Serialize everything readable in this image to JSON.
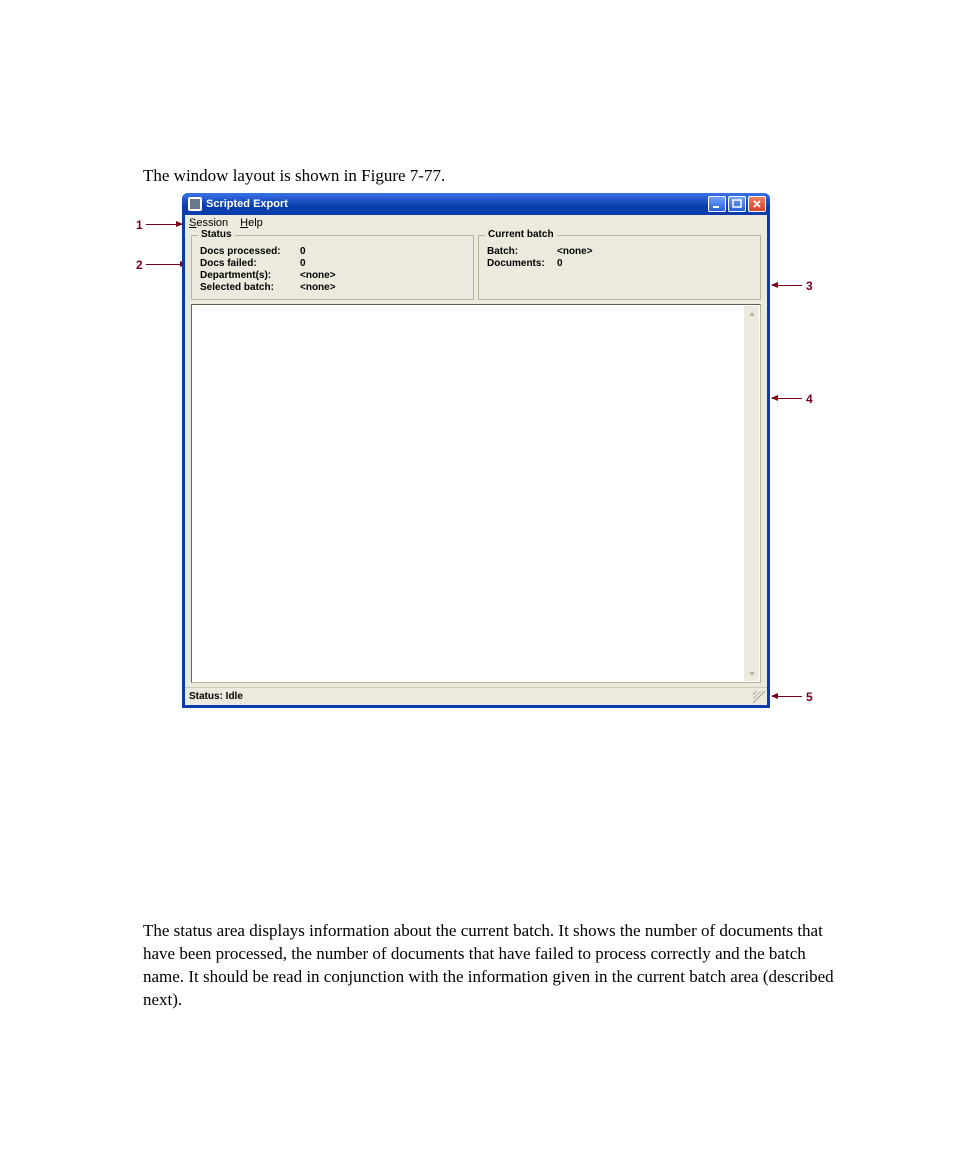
{
  "intro": "The window layout is shown in Figure 7-77.",
  "window": {
    "title": "Scripted Export",
    "menu": {
      "session": "Session",
      "help": "Help"
    },
    "buttons": {
      "min": "minimize",
      "max": "maximize",
      "close": "close"
    }
  },
  "status": {
    "title": "Status",
    "rows": [
      {
        "label": "Docs processed:",
        "value": "0"
      },
      {
        "label": "Docs failed:",
        "value": "0"
      },
      {
        "label": "Department(s):",
        "value": "<none>"
      },
      {
        "label": "Selected batch:",
        "value": "<none>"
      }
    ]
  },
  "current_batch": {
    "title": "Current batch",
    "rows": [
      {
        "label": "Batch:",
        "value": "<none>"
      },
      {
        "label": "Documents:",
        "value": "0"
      }
    ]
  },
  "statusbar": "Status: Idle",
  "callouts": {
    "c1": "1",
    "c2": "2",
    "c3": "3",
    "c4": "4",
    "c5": "5"
  },
  "para2": "The status area displays information about the current batch. It shows the number of documents that have been processed, the number of documents that have failed to process correctly and the batch name. It should be read in conjunction with the information given in the current batch area (described next)."
}
